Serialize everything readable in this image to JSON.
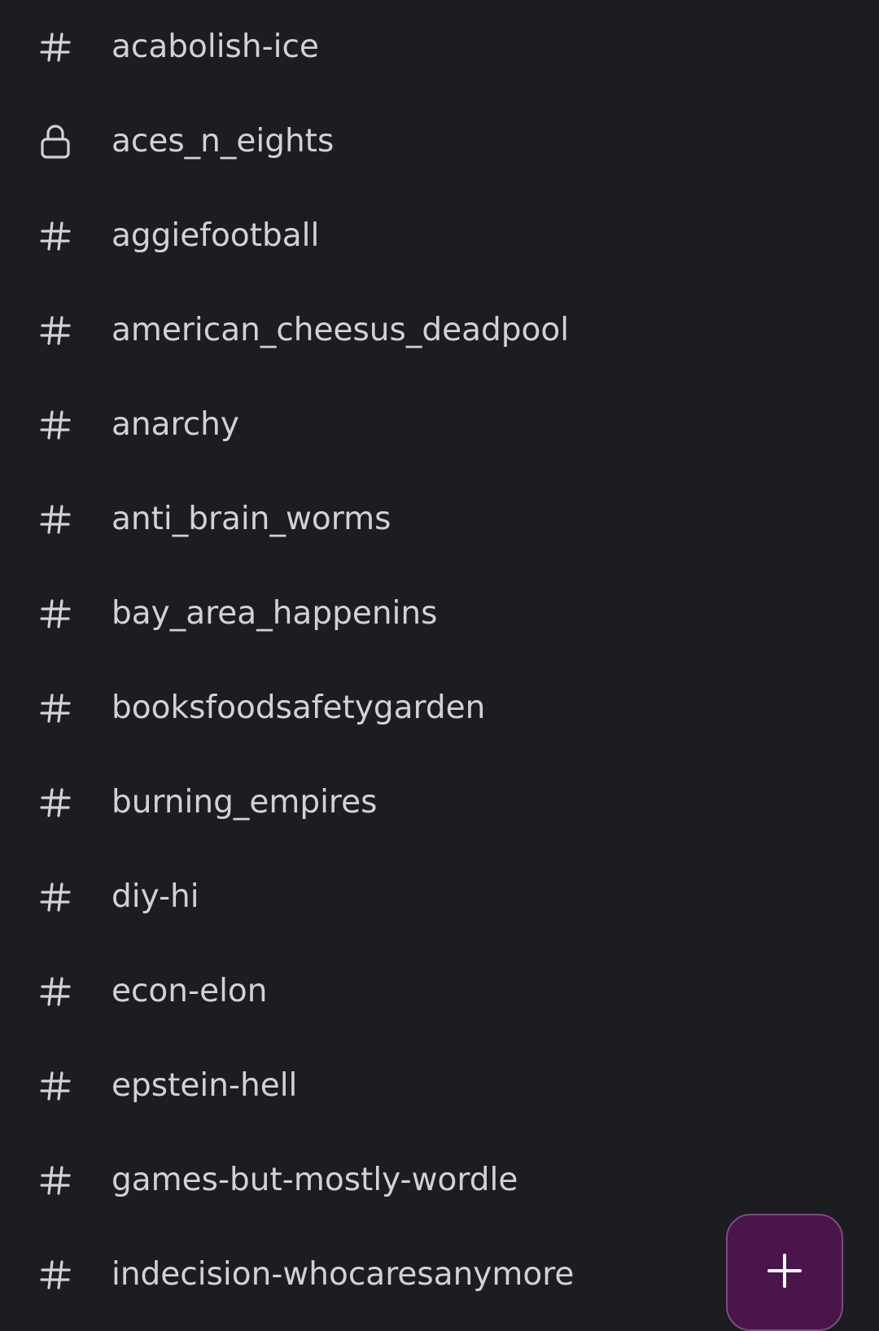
{
  "channels": [
    {
      "name": "acabolish-ice",
      "icon": "hash-icon"
    },
    {
      "name": "aces_n_eights",
      "icon": "lock-icon"
    },
    {
      "name": "aggiefootball",
      "icon": "hash-icon"
    },
    {
      "name": "american_cheesus_deadpool",
      "icon": "hash-icon"
    },
    {
      "name": "anarchy",
      "icon": "hash-icon"
    },
    {
      "name": "anti_brain_worms",
      "icon": "hash-icon"
    },
    {
      "name": "bay_area_happenins",
      "icon": "hash-icon"
    },
    {
      "name": "booksfoodsafetygarden",
      "icon": "hash-icon"
    },
    {
      "name": "burning_empires",
      "icon": "hash-icon"
    },
    {
      "name": "diy-hi",
      "icon": "hash-icon"
    },
    {
      "name": "econ-elon",
      "icon": "hash-icon"
    },
    {
      "name": "epstein-hell",
      "icon": "hash-icon"
    },
    {
      "name": "games-but-mostly-wordle",
      "icon": "hash-icon"
    },
    {
      "name": "indecision-whocaresanymore",
      "icon": "hash-icon"
    }
  ],
  "fab": {
    "icon": "plus-icon"
  },
  "colors": {
    "background": "#1b1d21",
    "text": "#d1d2d3",
    "fab_background": "#4a154b",
    "fab_border": "#7a4e7c"
  }
}
